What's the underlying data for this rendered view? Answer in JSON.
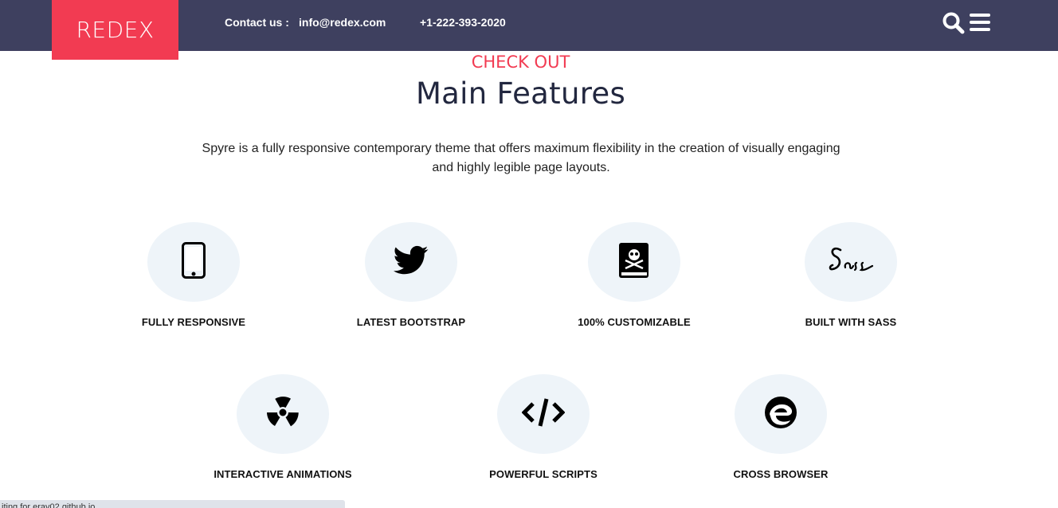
{
  "header": {
    "logo": "REDEX",
    "contact_label": "Contact us :",
    "email": "info@redex.com",
    "phone": "+1-222-393-2020",
    "search_icon": "search-icon",
    "menu_icon": "hamburger-menu-icon",
    "background_color": "#3e405f",
    "logo_color": "#f23b52"
  },
  "section": {
    "kicker": "CHECK OUT",
    "title": "Main Features",
    "intro": "Spyre is a fully responsive contemporary theme that offers maximum flexibility in the creation of visually engaging and highly legible page layouts.",
    "accent_color": "#f23b52",
    "title_color": "#22273f"
  },
  "features": [
    {
      "icon": "mobile-phone-icon",
      "label": "FULLY RESPONSIVE"
    },
    {
      "icon": "twitter-bird-icon",
      "label": "LATEST BOOTSTRAP"
    },
    {
      "icon": "skull-crossbones-book-icon",
      "label": "100% CUSTOMIZABLE"
    },
    {
      "icon": "sass-logo-icon",
      "label": "BUILT WITH SASS"
    },
    {
      "icon": "radiation-icon",
      "label": "INTERACTIVE ANIMATIONS"
    },
    {
      "icon": "code-icon",
      "label": "POWERFUL SCRIPTS"
    },
    {
      "icon": "edge-browser-icon",
      "label": "CROSS BROWSER"
    }
  ],
  "status_bar": {
    "text": "iting for erav02.github.io..."
  }
}
